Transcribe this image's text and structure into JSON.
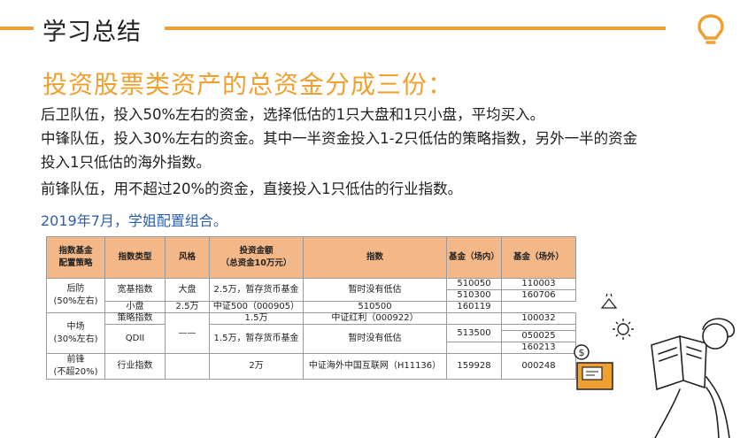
{
  "header": {
    "title": "学习总结"
  },
  "headline": "投资股票类资产的总资金分成三份：",
  "paragraphs": [
    "后卫队伍，投入50%左右的资金，选择低估的1只大盘和1只小盘，平均买入。",
    "中锋队伍，投入30%左右的资金。其中一半资金投入1-2只低估的策略指数，另外一半的资金",
    "投入1只低估的海外指数。",
    "前锋队伍，用不超过20%的资金，直接投入1只低估的行业指数。"
  ],
  "subtitle": "2019年7月，学姐配置组合。",
  "table": {
    "headers": [
      "指数基金\n配置策略",
      "指数类型",
      "风格",
      "投资金额\n（总资金10万元）",
      "指数",
      "基金（场内）",
      "基金（场外）"
    ],
    "groups": {
      "back": "后防\n(50%左右)",
      "mid": "中场\n(30%左右)",
      "front": "前锋\n(不超20%)"
    },
    "types": {
      "broad": "宽基指数",
      "strategy": "策略指数",
      "qdii": "QDII",
      "industry": "行业指数"
    },
    "styles": {
      "large": "大盘",
      "small": "小盘",
      "none": "——"
    },
    "amounts": {
      "a1": "2.5万，暂存货币基金",
      "a2": "2.5万",
      "a3": "1.5万",
      "a4": "1.5万，暂存货币基金",
      "a5": "2万"
    },
    "indices": {
      "i1": "暂时没有低估",
      "i2": "中证500（000905）",
      "i3": "中证红利（000922）",
      "i4": "暂时没有低估",
      "i5": "中证海外中国互联网（H11136）"
    },
    "onsite": [
      "510050",
      "510300",
      "510500",
      "",
      "513500",
      "159928"
    ],
    "offsite": [
      "110003",
      "160706",
      "160119",
      "100032",
      "050025",
      "160213",
      "000248"
    ]
  },
  "colors": {
    "accent": "#f0a030",
    "header_fill": "#f4b888",
    "subtitle": "#2f5fa8"
  },
  "icons": [
    "lightbulb-icon",
    "sun-icon",
    "dollar-coin-icon"
  ]
}
